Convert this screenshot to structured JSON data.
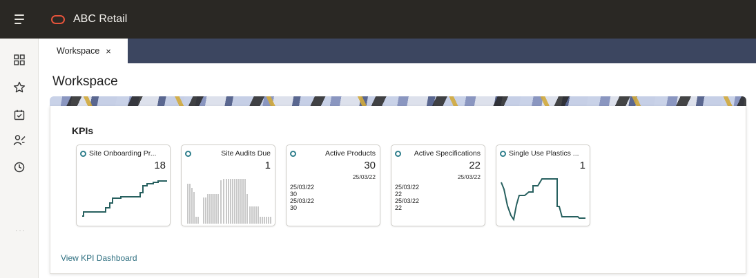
{
  "app": {
    "title": "ABC Retail"
  },
  "tabs": [
    {
      "label": "Workspace",
      "close": "×"
    }
  ],
  "page": {
    "title": "Workspace"
  },
  "kpis": {
    "title": "KPIs",
    "link": "View KPI Dashboard",
    "cards": [
      {
        "title": "Site Onboarding Pr...",
        "value": "18",
        "chart": "line-step",
        "status": "circle-outline-icon"
      },
      {
        "title": "Site Audits Due",
        "value": "1",
        "chart": "bar",
        "status": "circle-outline-icon"
      },
      {
        "title": "Active Products",
        "value": "30",
        "date": "25/03/22",
        "details": [
          "25/03/22",
          "30",
          "25/03/22",
          "30"
        ],
        "status": "circle-outline-icon"
      },
      {
        "title": "Active Specifications",
        "value": "22",
        "date": "25/03/22",
        "details": [
          "25/03/22",
          "22",
          "25/03/22",
          "22"
        ],
        "status": "circle-outline-icon"
      },
      {
        "title": "Single Use Plastics ...",
        "value": "1",
        "chart": "line",
        "status": "circle-outline-icon"
      }
    ]
  },
  "sidebar": {
    "icons": [
      "grid-icon",
      "star-icon",
      "calendar-check-icon",
      "people-icon",
      "clock-icon"
    ]
  },
  "colors": {
    "topbar": "#2a2824",
    "tabstrip": "#3c4660",
    "accent": "#2f7f8c",
    "link": "#2e6f80",
    "logo": "#e4533b"
  }
}
